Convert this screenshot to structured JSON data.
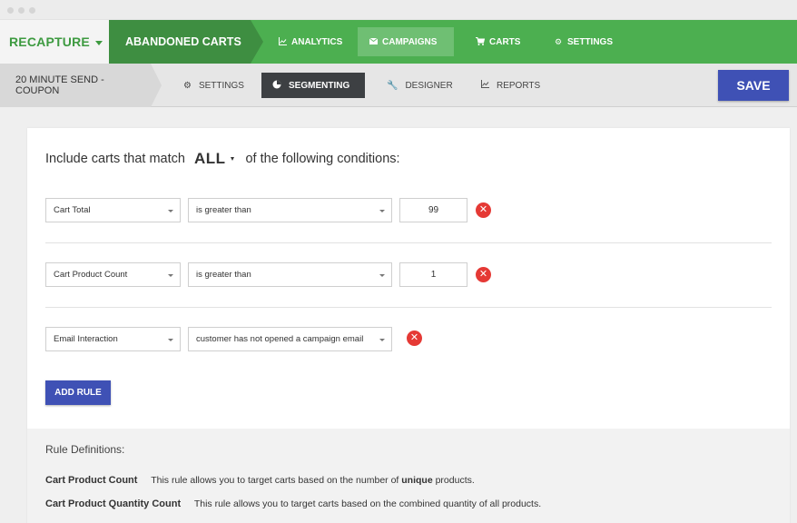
{
  "brand": {
    "label": "RECAPTURE"
  },
  "section": {
    "label": "ABANDONED CARTS"
  },
  "topnav": [
    {
      "label": "ANALYTICS",
      "icon": "chart-icon",
      "active": false
    },
    {
      "label": "CAMPAIGNS",
      "icon": "envelope-icon",
      "active": true
    },
    {
      "label": "CARTS",
      "icon": "cart-icon",
      "active": false
    },
    {
      "label": "SETTINGS",
      "icon": "gear-icon",
      "active": false
    }
  ],
  "campaign": {
    "name": "20 MINUTE SEND - COUPON"
  },
  "subnav": [
    {
      "label": "SETTINGS",
      "icon": "gear-icon",
      "active": false
    },
    {
      "label": "SEGMENTING",
      "icon": "pie-icon",
      "active": true
    },
    {
      "label": "DESIGNER",
      "icon": "wrench-icon",
      "active": false
    },
    {
      "label": "REPORTS",
      "icon": "chart-icon",
      "active": false
    }
  ],
  "save_label": "SAVE",
  "conditions": {
    "prefix": "Include carts that match",
    "match": "ALL",
    "suffix": "of the following conditions:"
  },
  "rules": [
    {
      "field": "Cart Total",
      "operator": "is greater than",
      "value": "99"
    },
    {
      "field": "Cart Product Count",
      "operator": "is greater than",
      "value": "1"
    },
    {
      "field": "Email Interaction",
      "operator": "customer has not opened a campaign email",
      "value": null
    }
  ],
  "add_rule_label": "ADD RULE",
  "definitions": {
    "title": "Rule Definitions:",
    "items": [
      {
        "term": "Cart Product Count",
        "text_before": "This rule allows you to target carts based on the number of ",
        "bold": "unique",
        "text_after": " products."
      },
      {
        "term": "Cart Product Quantity Count",
        "text_before": "This rule allows you to target carts based on the combined quantity of all products.",
        "bold": "",
        "text_after": ""
      }
    ]
  },
  "colors": {
    "green": "#4caf50",
    "dark_green": "#3e8e41",
    "blue": "#3f51b5",
    "red": "#e53935",
    "dark_tab": "#3d4043"
  }
}
